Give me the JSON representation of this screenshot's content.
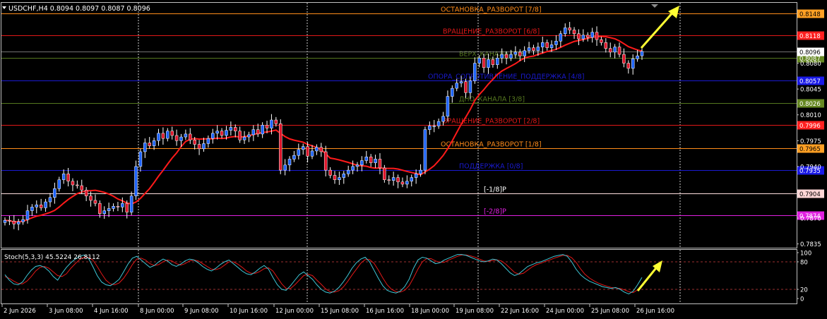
{
  "chart_title": "USDCHF,H4  0.8094 0.8097 0.8087 0.8096",
  "osc_title": "Stoch(5,3,3) 45.5224 26.8112",
  "colors": {
    "background": "#000000",
    "bull_candle": "#1e64ff",
    "bear_candle": "#e0162b",
    "moving_average": "#ff1a1a",
    "annotation_arrow": "#ffff33",
    "stoch_main": "#3ec8d8",
    "stoch_signal": "#e01818",
    "grid": "#ffffff",
    "frame": "#c0c0c0"
  },
  "levels": [
    {
      "name": "ОСТАНОВКА_РАЗВОРОТ [7/8]",
      "price": 0.8148,
      "tag": "0.8148",
      "color": "#ff8c1a",
      "text_color": "#ff8c1a",
      "box_fill": "#ffa024",
      "box_text": "#000000"
    },
    {
      "name": "ВРАЩЕНИЕ_РАЗВОРОТ [6/8]",
      "price": 0.8118,
      "tag": "0.8118",
      "color": "#e01818",
      "text_color": "#e01818",
      "box_fill": "#ff2020",
      "box_text": "#ffffff"
    },
    {
      "name": "ВЕРХ_КАНАЛА [5/8]",
      "price": 0.8087,
      "tag": "0.8087",
      "color": "#55771f",
      "text_color": "#55771f",
      "box_fill": "#668822",
      "box_text": "#ffffff"
    },
    {
      "name": "ОПОРА_СОПРОТИВЛЕНИЕ_ПОДДЕРЖКА [4/8]",
      "price": 0.8057,
      "tag": "0.8057",
      "color": "#1a1ad0",
      "text_color": "#1a1ad0",
      "box_fill": "#1a1ae8",
      "box_text": "#ffffff"
    },
    {
      "name": "ДНО_КАНАЛА [3/8]",
      "price": 0.8026,
      "tag": "0.8026",
      "color": "#55771f",
      "text_color": "#55771f",
      "box_fill": "#668822",
      "box_text": "#ffffff"
    },
    {
      "name": "ВРАЩЕНИЕ_РАЗВОРОТ [2/8]",
      "price": 0.7996,
      "tag": "0.7996",
      "color": "#e01818",
      "text_color": "#e01818",
      "box_fill": "#ff2020",
      "box_text": "#ffffff"
    },
    {
      "name": "ОСТАНОВКА_РАЗВОРОТ [1/8]",
      "price": 0.7965,
      "tag": "0.7965",
      "color": "#ff8c1a",
      "text_color": "#ff8c1a",
      "box_fill": "#ffa024",
      "box_text": "#000000"
    },
    {
      "name": "ПОДДЕРЖКА [0/8]",
      "price": 0.7935,
      "tag": "0.7935",
      "color": "#1a1ad0",
      "text_color": "#1a1ad0",
      "box_fill": "#1a1ae8",
      "box_text": "#ffffff"
    },
    {
      "name": "[-1/8]P",
      "price": 0.7904,
      "tag": "0.7904",
      "color": "#ffe0e0",
      "text_color": "#ffffff",
      "box_fill": "#ffd6d6",
      "box_text": "#000000"
    },
    {
      "name": "[-2/8]P",
      "price": 0.7874,
      "tag": "0.7874",
      "color": "#e020e0",
      "text_color": "#e020e0",
      "box_fill": "#e020e0",
      "box_text": "#ffffff"
    }
  ],
  "current_price": {
    "value": 0.8096,
    "tag": "0.8096"
  },
  "price_axis_labels": [
    "0.8080",
    "0.8045",
    "0.8010",
    "0.7975",
    "0.7940",
    "0.7870",
    "0.7835"
  ],
  "price_axis_values": [
    0.808,
    0.8045,
    0.801,
    0.7975,
    0.794,
    0.787,
    0.7835
  ],
  "osc_axis_labels": [
    "100",
    "80",
    "20",
    "0"
  ],
  "osc_axis_values": [
    100,
    80,
    20,
    0
  ],
  "osc_levels": [
    80,
    20
  ],
  "time_labels": [
    "2 Jun 2026",
    "3 Jun 08:00",
    "4 Jun 16:00",
    "8 Jun 00:00",
    "9 Jun 08:00",
    "10 Jun 16:00",
    "12 Jun 00:00",
    "15 Jun 08:00",
    "16 Jun 16:00",
    "18 Jun 00:00",
    "19 Jun 08:00",
    "22 Jun 16:00",
    "24 Jun 00:00",
    "25 Jun 08:00",
    "26 Jun 16:00"
  ],
  "chart_data": {
    "type": "candlestick",
    "symbol": "USDCHF",
    "timeframe": "H4",
    "ohlc_last": {
      "open": 0.8094,
      "high": 0.8097,
      "low": 0.8087,
      "close": 0.8096
    },
    "closes": [
      0.7867,
      0.7866,
      0.7862,
      0.7865,
      0.7868,
      0.788,
      0.7885,
      0.7888,
      0.7884,
      0.7892,
      0.7898,
      0.791,
      0.7922,
      0.793,
      0.792,
      0.7915,
      0.7914,
      0.7908,
      0.79,
      0.7894,
      0.789,
      0.7876,
      0.788,
      0.7883,
      0.7886,
      0.7885,
      0.789,
      0.7878,
      0.79,
      0.794,
      0.796,
      0.7972,
      0.7968,
      0.7975,
      0.7985,
      0.7978,
      0.7988,
      0.7982,
      0.7975,
      0.798,
      0.7984,
      0.7976,
      0.797,
      0.7964,
      0.7971,
      0.7978,
      0.7985,
      0.7988,
      0.7982,
      0.7989,
      0.7993,
      0.7988,
      0.7976,
      0.798,
      0.7983,
      0.799,
      0.7984,
      0.7996,
      0.7992,
      0.8003,
      0.7998,
      0.7935,
      0.7942,
      0.795,
      0.7955,
      0.7963,
      0.7967,
      0.7954,
      0.7961,
      0.7966,
      0.796,
      0.7935,
      0.7928,
      0.7922,
      0.7925,
      0.793,
      0.7935,
      0.794,
      0.7942,
      0.7948,
      0.7953,
      0.7945,
      0.795,
      0.7938,
      0.7922,
      0.7921,
      0.7925,
      0.7919,
      0.7916,
      0.792,
      0.7925,
      0.793,
      0.7935,
      0.799,
      0.7995,
      0.7995,
      0.8001,
      0.8008,
      0.8035,
      0.8046,
      0.8053,
      0.8055,
      0.804,
      0.8056,
      0.808,
      0.8087,
      0.8074,
      0.8085,
      0.8078,
      0.8087,
      0.8092,
      0.8087,
      0.8092,
      0.8095,
      0.809,
      0.8097,
      0.8101,
      0.8097,
      0.8102,
      0.8108,
      0.8101,
      0.8105,
      0.811,
      0.812,
      0.8128,
      0.8125,
      0.812,
      0.8113,
      0.8118,
      0.8115,
      0.8122,
      0.8112,
      0.8108,
      0.81,
      0.8095,
      0.8102,
      0.8092,
      0.808,
      0.8073,
      0.8086,
      0.809,
      0.8096
    ],
    "stoch_main": [
      52,
      40,
      32,
      30,
      36,
      50,
      62,
      70,
      72,
      68,
      60,
      48,
      40,
      55,
      68,
      78,
      86,
      92,
      95,
      88,
      70,
      50,
      36,
      30,
      28,
      34,
      42,
      58,
      75,
      88,
      92,
      84,
      76,
      68,
      72,
      80,
      86,
      82,
      74,
      70,
      75,
      82,
      86,
      84,
      78,
      70,
      64,
      60,
      66,
      74,
      80,
      84,
      76,
      68,
      60,
      54,
      52,
      58,
      66,
      72,
      64,
      46,
      30,
      20,
      18,
      28,
      40,
      52,
      58,
      50,
      42,
      30,
      20,
      14,
      12,
      16,
      24,
      36,
      50,
      66,
      78,
      86,
      90,
      80,
      62,
      44,
      28,
      18,
      14,
      12,
      16,
      26,
      42,
      66,
      84,
      90,
      88,
      82,
      76,
      78,
      84,
      88,
      92,
      96,
      96,
      94,
      90,
      86,
      82,
      80,
      82,
      86,
      84,
      76,
      66,
      56,
      50,
      54,
      62,
      70,
      74,
      78,
      80,
      84,
      88,
      92,
      94,
      96,
      92,
      80,
      64,
      52,
      44,
      38,
      34,
      30,
      26,
      24,
      22,
      24,
      20,
      14,
      10,
      16,
      30,
      46
    ],
    "stoch_signal": [
      48,
      44,
      38,
      33,
      32,
      38,
      48,
      60,
      68,
      70,
      66,
      58,
      50,
      48,
      54,
      66,
      76,
      85,
      90,
      90,
      84,
      70,
      54,
      40,
      32,
      30,
      34,
      44,
      58,
      74,
      86,
      88,
      84,
      76,
      72,
      74,
      80,
      84,
      82,
      76,
      73,
      76,
      82,
      84,
      82,
      76,
      70,
      64,
      63,
      66,
      73,
      80,
      80,
      75,
      68,
      60,
      55,
      55,
      59,
      65,
      67,
      60,
      46,
      32,
      22,
      22,
      30,
      40,
      50,
      53,
      50,
      40,
      31,
      21,
      15,
      14,
      17,
      25,
      37,
      51,
      64,
      77,
      85,
      85,
      77,
      62,
      45,
      30,
      20,
      15,
      14,
      18,
      28,
      45,
      64,
      80,
      87,
      87,
      82,
      79,
      79,
      84,
      88,
      92,
      95,
      95,
      93,
      90,
      86,
      82,
      81,
      83,
      84,
      82,
      75,
      66,
      57,
      53,
      55,
      62,
      69,
      74,
      77,
      81,
      84,
      88,
      91,
      94,
      94,
      89,
      79,
      65,
      53,
      45,
      39,
      34,
      30,
      27,
      24,
      23,
      22,
      19,
      15,
      13,
      19,
      27
    ]
  }
}
